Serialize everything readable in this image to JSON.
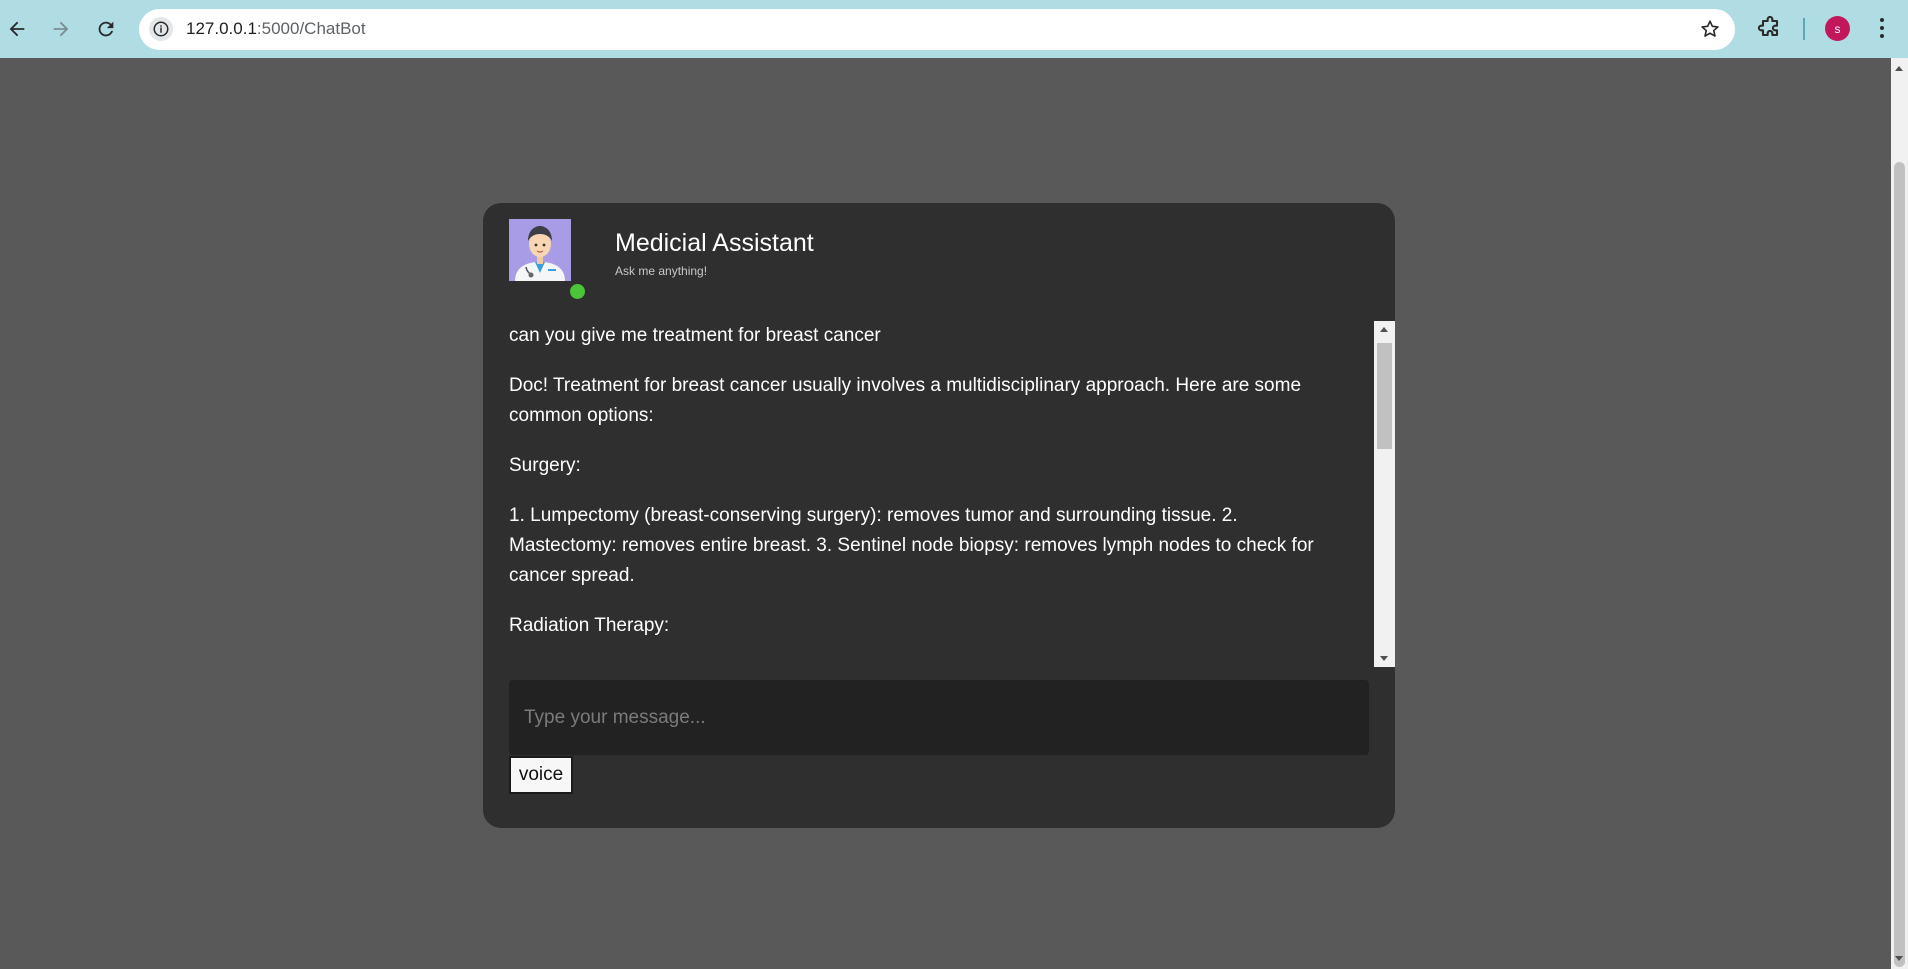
{
  "browser": {
    "url_host": "127.0.0.1",
    "url_rest": ":5000/ChatBot",
    "profile_initial": "s",
    "icons": [
      "back-icon",
      "forward-icon",
      "reload-icon",
      "site-info-icon",
      "bookmark-star-icon",
      "extensions-icon",
      "menu-dots-icon"
    ]
  },
  "chat": {
    "title": "Medicial Assistant",
    "subtitle": "Ask me anything!",
    "status_color": "#4cc43a",
    "messages": [
      "can you give me treatment for breast cancer",
      "Doc! Treatment for breast cancer usually involves a multidisciplinary approach. Here are some common options:",
      "Surgery:",
      "1. Lumpectomy (breast-conserving surgery): removes tumor and surrounding tissue. 2. Mastectomy: removes entire breast. 3. Sentinel node biopsy: removes lymph nodes to check for cancer spread.",
      "Radiation Therapy:"
    ],
    "input_placeholder": "Type your message...",
    "voice_label": "voice"
  }
}
